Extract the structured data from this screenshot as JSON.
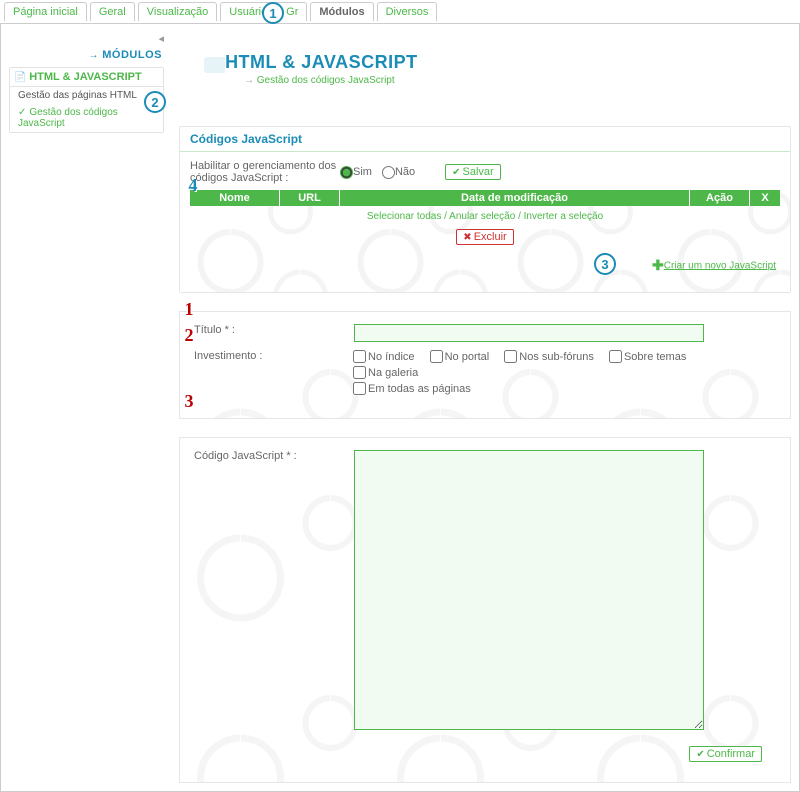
{
  "tabs": [
    "Página inicial",
    "Geral",
    "Visualização",
    "Usuários & Gr",
    "Módulos",
    "Diversos"
  ],
  "active_tab": 4,
  "sidebar": {
    "mods_label": "MÓDULOS",
    "box_title": "HTML & JAVASCRIPT",
    "items": [
      "Gestão das páginas HTML",
      "Gestão dos códigos JavaScript"
    ],
    "selected": 1
  },
  "header": {
    "title": "HTML & JAVASCRIPT",
    "breadcrumb": "Gestão dos códigos JavaScript"
  },
  "panel1": {
    "title": "Códigos JavaScript",
    "enable_label": "Habilitar o gerenciamento dos códigos JavaScript :",
    "opt_yes": "Sim",
    "opt_no": "Não",
    "save": "Salvar",
    "cols": {
      "nome": "Nome",
      "url": "URL",
      "data": "Data de modificação",
      "acao": "Ação",
      "x": "X"
    },
    "sel_links": "Selecionar todas / Anular seleção / Inverter a seleção",
    "excluir": "Excluir",
    "create": "Criar um novo JavaScript"
  },
  "form": {
    "titulo_label": "Título * :",
    "inv_label": "Investimento :",
    "checks": [
      "No índice",
      "No portal",
      "Nos sub-fóruns",
      "Sobre temas",
      "Na galeria",
      "Em todas as páginas"
    ],
    "code_label": "Código JavaScript * :",
    "confirm": "Confirmar"
  },
  "callouts": {
    "c1": "1",
    "c2": "2",
    "c3": "3",
    "c4": "4",
    "r1": "1",
    "r2": "2",
    "r3": "3"
  }
}
